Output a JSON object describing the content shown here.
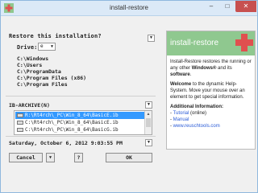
{
  "window": {
    "title": "install-restore",
    "minimize": "–",
    "maximize": "□",
    "close": "✕"
  },
  "restore": {
    "question": "Restore this installation?",
    "drive_label": "Drive:",
    "drive_value": "e",
    "paths": [
      "C:\\Windows",
      "C:\\Users",
      "C:\\ProgramData",
      "C:\\Program Files (x86)",
      "C:\\Program Files"
    ]
  },
  "archives": {
    "label": "IB-ARCHIVE(N)",
    "items": [
      {
        "text": "R:\\Rt4rch\\_PC\\Win_8_64\\BasicE.ib",
        "selected": true
      },
      {
        "text": "C:\\Rt4rch\\_PC\\Win_8_64\\BasicE.ib",
        "selected": false
      },
      {
        "text": "C:\\Rt4rch\\_PC\\Win_8_64\\BasicG.ib",
        "selected": false
      }
    ]
  },
  "datetime": "Saturday, October 6, 2012   9:03:55 PM",
  "buttons": {
    "cancel": "Cancel",
    "cancel_dropdown": "▼",
    "help": "?",
    "ok": "OK",
    "expand": "▼"
  },
  "info": {
    "brand": "install-restore",
    "intro_prefix": "Install-Restore restores the running or any other ",
    "intro_windows": "Windows®",
    "intro_mid": " and its ",
    "intro_software": "software",
    "intro_end": ".",
    "welcome_bold": "Welcome",
    "welcome_text": " to the dynamic Help-System. Move your mouse over an element to get special information.",
    "additional_heading": "Additional Information:",
    "links": [
      {
        "prefix": "- ",
        "label": "Tutorial",
        "suffix": " (online)"
      },
      {
        "prefix": "- ",
        "label": "Manual",
        "suffix": ""
      },
      {
        "prefix": "- ",
        "label": "www.reuschtools.com",
        "suffix": ""
      }
    ]
  },
  "colors": {
    "brand_green": "#8fc88f",
    "accent_red": "#e0504f",
    "selection_blue": "#3399ff",
    "link_blue": "#2a5bd7",
    "close_red": "#c75050"
  }
}
